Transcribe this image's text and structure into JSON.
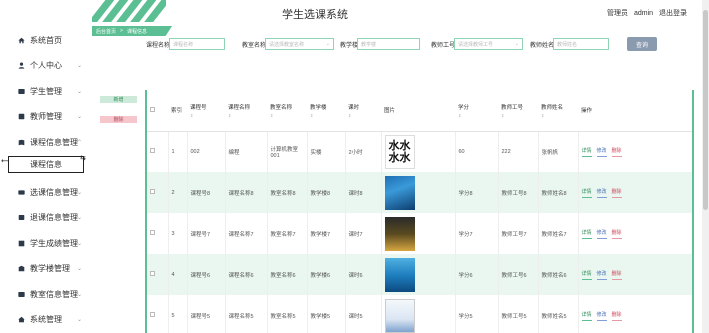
{
  "header": {
    "site_title": "学生选课系统",
    "role": "管理员",
    "username": "admin",
    "logout": "退出登录"
  },
  "breadcrumb": [
    "后台首页",
    ">",
    "课程信息"
  ],
  "sidebar": {
    "items": [
      {
        "label": "系统首页",
        "icon": "home-icon"
      },
      {
        "label": "个人中心",
        "icon": "user-icon"
      },
      {
        "label": "学生管理",
        "icon": "users-icon"
      },
      {
        "label": "教师管理",
        "icon": "teacher-icon"
      },
      {
        "label": "课程信息管理",
        "icon": "book-icon"
      },
      {
        "label": "选课信息管理",
        "icon": "card-icon"
      },
      {
        "label": "退课信息管理",
        "icon": "exit-icon"
      },
      {
        "label": "学生成绩管理",
        "icon": "grade-icon"
      },
      {
        "label": "教学楼管理",
        "icon": "building-icon"
      },
      {
        "label": "教室信息管理",
        "icon": "classroom-icon"
      },
      {
        "label": "系统管理",
        "icon": "system-icon"
      }
    ],
    "active_sub": "课程信息"
  },
  "filters": {
    "course_name_label": "课程名称",
    "course_name_placeholder": "课程名称",
    "teacher_room_label": "教室名称",
    "teacher_room_placeholder": "请选择教室名称",
    "building_label": "教学楼",
    "building_placeholder": "教学楼",
    "teacher_id_label": "教师工号",
    "teacher_id_placeholder": "请选择教师工号",
    "teacher_name_label": "教师姓名",
    "teacher_name_placeholder": "教师姓名",
    "search_label": "查询"
  },
  "actions": {
    "add": "新增",
    "delete": "删除"
  },
  "table": {
    "headers": [
      "",
      "索引",
      "课程号",
      "课程名称",
      "教室名称",
      "教学楼",
      "课时",
      "图片",
      "学分",
      "教师工号",
      "教师姓名",
      "操作"
    ],
    "rows": [
      {
        "index": "1",
        "course_no": "002",
        "course_name": "编程",
        "room": "计算机教室001",
        "building": "实楼",
        "hours": "2小时",
        "image": "text",
        "credit": "60",
        "teacher_id": "222",
        "teacher_name": "张帆帆"
      },
      {
        "index": "2",
        "course_no": "课程号8",
        "course_name": "课程名称8",
        "room": "教室名称8",
        "building": "教学楼8",
        "hours": "课时8",
        "image": "blue",
        "credit": "学分8",
        "teacher_id": "教师工号8",
        "teacher_name": "教师姓名8"
      },
      {
        "index": "3",
        "course_no": "课程号7",
        "course_name": "课程名称7",
        "room": "教室名称7",
        "building": "教学楼7",
        "hours": "课时7",
        "image": "dark",
        "credit": "学分7",
        "teacher_id": "教师工号7",
        "teacher_name": "教师姓名7"
      },
      {
        "index": "4",
        "course_no": "课程号6",
        "course_name": "课程名称6",
        "room": "教室名称6",
        "building": "教学楼6",
        "hours": "课时6",
        "image": "cyan",
        "credit": "学分6",
        "teacher_id": "教师工号6",
        "teacher_name": "教师姓名6"
      },
      {
        "index": "5",
        "course_no": "课程号5",
        "course_name": "课程名称5",
        "room": "教室名称5",
        "building": "教学楼5",
        "hours": "课时5",
        "image": "white",
        "credit": "学分5",
        "teacher_id": "教师工号5",
        "teacher_name": "教师姓名5"
      }
    ],
    "ops": {
      "detail": "详情",
      "edit": "修改",
      "delete": "删除"
    },
    "sort_hint": "⇕",
    "image_text": "水水水水"
  },
  "colors": {
    "accent": "#5bbf93",
    "row_alt": "#e9f7f0",
    "search_btn": "#8a9bb0"
  }
}
